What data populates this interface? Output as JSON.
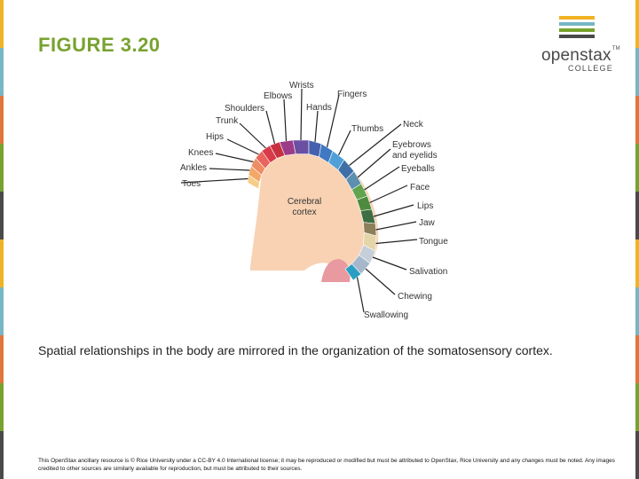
{
  "slide": {
    "title": "FIGURE 3.20",
    "caption": "Spatial relationships in the body are mirrored in the organization of the somatosensory cortex.",
    "license": "This OpenStax ancillary resource is © Rice University under a CC-BY 4.0 International license; it may be reproduced or modified but must be attributed to OpenStax, Rice University and any changes must be noted. Any images credited to other sources are similarly available for reproduction, but must be attributed to their sources."
  },
  "logo": {
    "wordmark": "openstax",
    "trademark": "TM",
    "subtitle": "COLLEGE",
    "stripe_colors": [
      "#f0b323",
      "#77b6c4",
      "#78a22f",
      "#4a4a4a"
    ]
  },
  "edge_colors": [
    "#f0b323",
    "#77b6c4",
    "#e0763c",
    "#78a22f",
    "#4a4a4a",
    "#f0b323",
    "#77b6c4",
    "#e0763c",
    "#78a22f",
    "#4a4a4a"
  ],
  "diagram": {
    "cortex_label": [
      "Cerebral",
      "cortex"
    ],
    "regions": [
      {
        "label": "Toes",
        "color": "#f6cd86"
      },
      {
        "label": "Ankles",
        "color": "#f3a86a"
      },
      {
        "label": "Knees",
        "color": "#ee8d63"
      },
      {
        "label": "Hips",
        "color": "#e8645c"
      },
      {
        "label": "Trunk",
        "color": "#d93a4a"
      },
      {
        "label": "Shoulders",
        "color": "#c8323f"
      },
      {
        "label": "Elbows",
        "color": "#9c3b88"
      },
      {
        "label": "Wrists",
        "color": "#6a4fa3"
      },
      {
        "label": "Hands",
        "color": "#4560ad"
      },
      {
        "label": "Fingers",
        "color": "#3f79c2"
      },
      {
        "label": "Thumbs",
        "color": "#4fa0d6"
      },
      {
        "label": "Neck",
        "color": "#3f6fa7"
      },
      {
        "label": "Eyebrows and eyelids",
        "color": "#5c8fb0"
      },
      {
        "label": "Eyeballs",
        "color": "#62a44d"
      },
      {
        "label": "Face",
        "color": "#4e8b3e"
      },
      {
        "label": "Lips",
        "color": "#3d6f43"
      },
      {
        "label": "Jaw",
        "color": "#8b7f5c"
      },
      {
        "label": "Tongue",
        "color": "#e6d5a8"
      },
      {
        "label": "Salivation",
        "color": "#c6cfd9"
      },
      {
        "label": "Chewing",
        "color": "#a6b7cb"
      },
      {
        "label": "Swallowing",
        "color": "#2b9fc3"
      }
    ]
  }
}
